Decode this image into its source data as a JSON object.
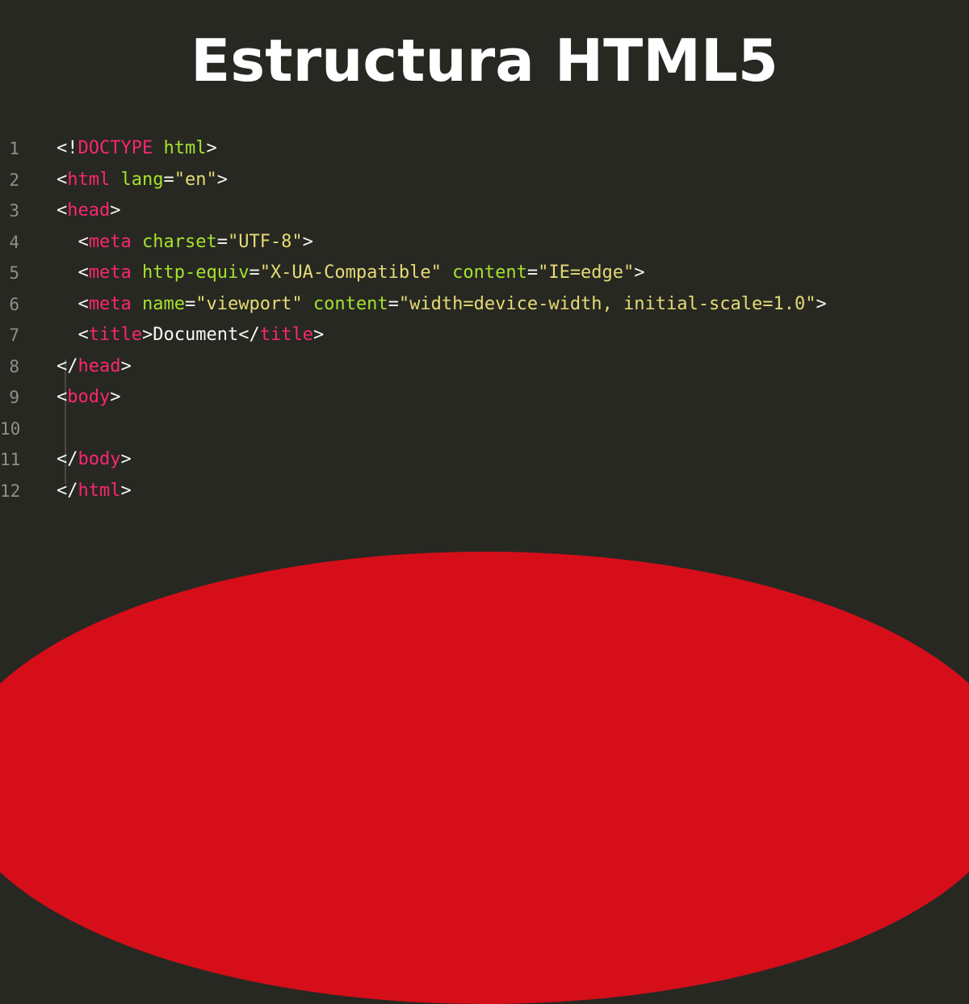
{
  "title": "Estructura HTML5",
  "colors": {
    "background": "#272822",
    "accent": "#d50e1a",
    "line_number": "#90908a",
    "punctuation": "#f8f8f2",
    "tag": "#f92672",
    "attribute": "#a6e22e",
    "string": "#e6db74",
    "text": "#f8f8f2"
  },
  "code": {
    "lines": [
      {
        "number": "1",
        "tokens": [
          {
            "type": "punct",
            "text": "<!"
          },
          {
            "type": "tag",
            "text": "DOCTYPE"
          },
          {
            "type": "text",
            "text": " "
          },
          {
            "type": "attr",
            "text": "html"
          },
          {
            "type": "punct",
            "text": ">"
          }
        ]
      },
      {
        "number": "2",
        "tokens": [
          {
            "type": "punct",
            "text": "<"
          },
          {
            "type": "tag",
            "text": "html"
          },
          {
            "type": "text",
            "text": " "
          },
          {
            "type": "attr",
            "text": "lang"
          },
          {
            "type": "punct",
            "text": "="
          },
          {
            "type": "string",
            "text": "\"en\""
          },
          {
            "type": "punct",
            "text": ">"
          }
        ]
      },
      {
        "number": "3",
        "tokens": [
          {
            "type": "punct",
            "text": "<"
          },
          {
            "type": "tag",
            "text": "head"
          },
          {
            "type": "punct",
            "text": ">"
          }
        ]
      },
      {
        "number": "4",
        "tokens": [
          {
            "type": "text",
            "text": "  "
          },
          {
            "type": "punct",
            "text": "<"
          },
          {
            "type": "tag",
            "text": "meta"
          },
          {
            "type": "text",
            "text": " "
          },
          {
            "type": "attr",
            "text": "charset"
          },
          {
            "type": "punct",
            "text": "="
          },
          {
            "type": "string",
            "text": "\"UTF-8\""
          },
          {
            "type": "punct",
            "text": ">"
          }
        ]
      },
      {
        "number": "5",
        "tokens": [
          {
            "type": "text",
            "text": "  "
          },
          {
            "type": "punct",
            "text": "<"
          },
          {
            "type": "tag",
            "text": "meta"
          },
          {
            "type": "text",
            "text": " "
          },
          {
            "type": "attr",
            "text": "http-equiv"
          },
          {
            "type": "punct",
            "text": "="
          },
          {
            "type": "string",
            "text": "\"X-UA-Compatible\""
          },
          {
            "type": "text",
            "text": " "
          },
          {
            "type": "attr",
            "text": "content"
          },
          {
            "type": "punct",
            "text": "="
          },
          {
            "type": "string",
            "text": "\"IE=edge\""
          },
          {
            "type": "punct",
            "text": ">"
          }
        ]
      },
      {
        "number": "6",
        "tokens": [
          {
            "type": "text",
            "text": "  "
          },
          {
            "type": "punct",
            "text": "<"
          },
          {
            "type": "tag",
            "text": "meta"
          },
          {
            "type": "text",
            "text": " "
          },
          {
            "type": "attr",
            "text": "name"
          },
          {
            "type": "punct",
            "text": "="
          },
          {
            "type": "string",
            "text": "\"viewport\""
          },
          {
            "type": "text",
            "text": " "
          },
          {
            "type": "attr",
            "text": "content"
          },
          {
            "type": "punct",
            "text": "="
          },
          {
            "type": "string",
            "text": "\"width=device-width, initial-scale=1.0\""
          },
          {
            "type": "punct",
            "text": ">"
          }
        ]
      },
      {
        "number": "7",
        "tokens": [
          {
            "type": "text",
            "text": "  "
          },
          {
            "type": "punct",
            "text": "<"
          },
          {
            "type": "tag",
            "text": "title"
          },
          {
            "type": "punct",
            "text": ">"
          },
          {
            "type": "text",
            "text": "Document"
          },
          {
            "type": "punct",
            "text": "</"
          },
          {
            "type": "tag",
            "text": "title"
          },
          {
            "type": "punct",
            "text": ">"
          }
        ]
      },
      {
        "number": "8",
        "tokens": [
          {
            "type": "punct",
            "text": "</"
          },
          {
            "type": "tag",
            "text": "head"
          },
          {
            "type": "punct",
            "text": ">"
          }
        ]
      },
      {
        "number": "9",
        "tokens": [
          {
            "type": "punct",
            "text": "<"
          },
          {
            "type": "tag",
            "text": "body"
          },
          {
            "type": "punct",
            "text": ">"
          }
        ]
      },
      {
        "number": "10",
        "tokens": []
      },
      {
        "number": "11",
        "tokens": [
          {
            "type": "punct",
            "text": "</"
          },
          {
            "type": "tag",
            "text": "body"
          },
          {
            "type": "punct",
            "text": ">"
          }
        ]
      },
      {
        "number": "12",
        "tokens": [
          {
            "type": "punct",
            "text": "</"
          },
          {
            "type": "tag",
            "text": "html"
          },
          {
            "type": "punct",
            "text": ">"
          }
        ]
      }
    ]
  }
}
